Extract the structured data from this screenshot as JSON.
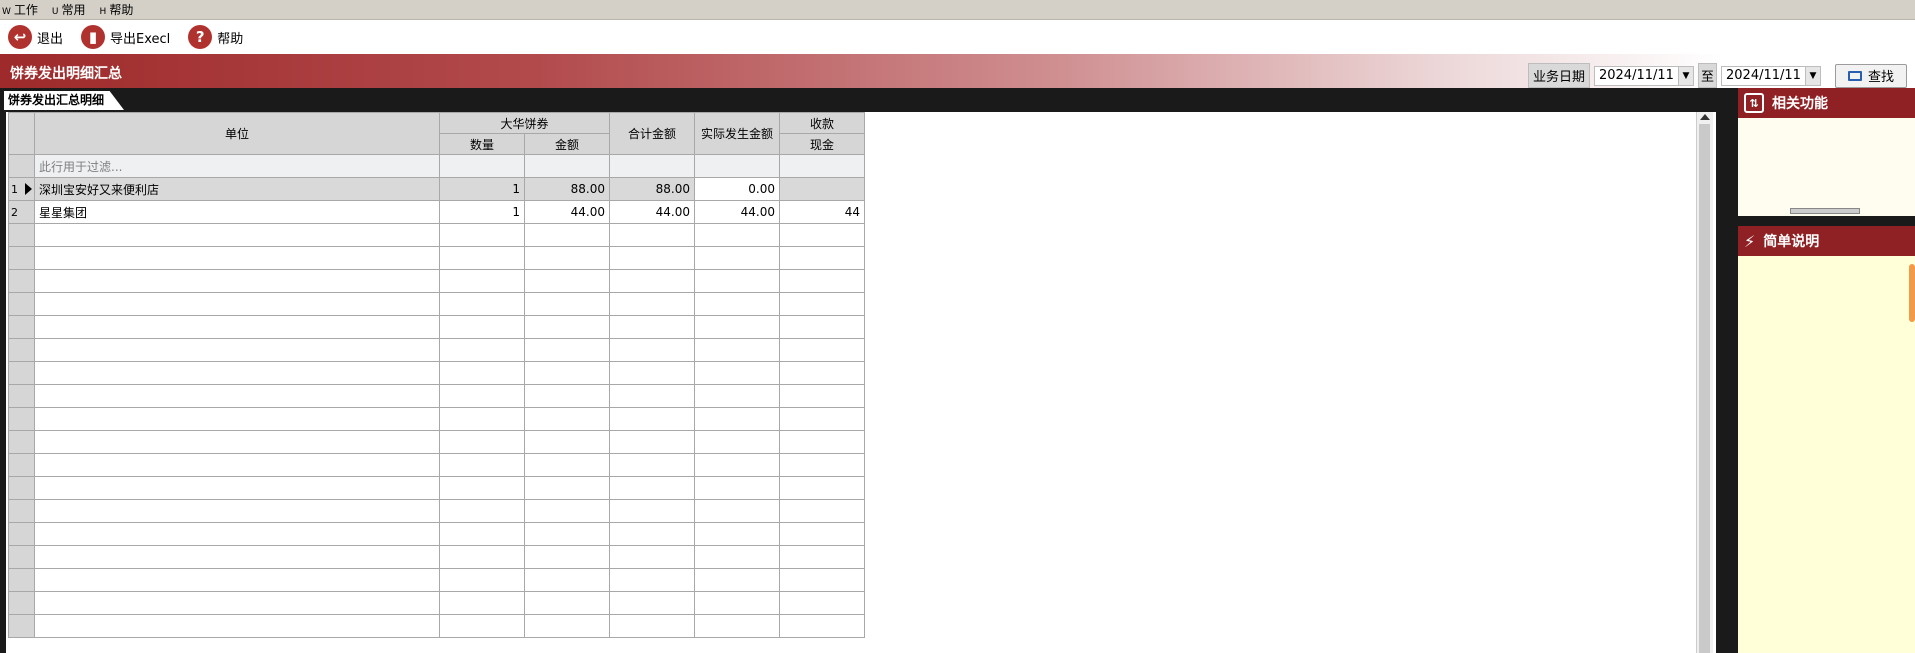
{
  "menu": [
    {
      "key": "W",
      "label": "工作"
    },
    {
      "key": "U",
      "label": "常用"
    },
    {
      "key": "H",
      "label": "帮助"
    }
  ],
  "toolbar": {
    "exit_label": "退出",
    "export_label": "导出Execl",
    "help_label": "帮助"
  },
  "header": {
    "title": "饼券发出明细汇总",
    "date_label": "业务日期",
    "date_from": "2024/11/11",
    "to_label": "至",
    "date_to": "2024/11/11",
    "find_label": "查找"
  },
  "tab": {
    "label": "饼券发出汇总明细"
  },
  "grid": {
    "headers": {
      "unit": "单位",
      "group_dahua": "大华饼券",
      "qty": "数量",
      "amount": "金额",
      "total": "合计金额",
      "actual": "实际发生金额",
      "receipt": "收款",
      "cash": "现金"
    },
    "filter_placeholder": "此行用于过滤...",
    "rows": [
      {
        "no": "1",
        "unit": "深圳宝安好又来便利店",
        "qty": "1",
        "amount": "88.00",
        "total": "88.00",
        "actual": "0.00",
        "cash": ""
      },
      {
        "no": "2",
        "unit": "星星集团",
        "qty": "1",
        "amount": "44.00",
        "total": "44.00",
        "actual": "44.00",
        "cash": "44"
      }
    ]
  },
  "side": {
    "related_title": "相关功能",
    "brief_title": "简单说明"
  }
}
